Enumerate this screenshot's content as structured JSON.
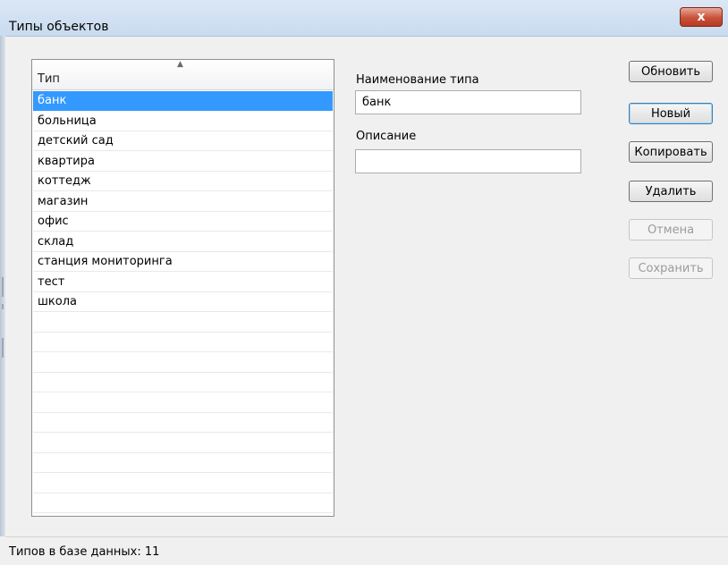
{
  "window": {
    "title": "Типы объектов",
    "close_glyph": "x"
  },
  "list": {
    "column_header": "Тип",
    "sort_glyph": "▲",
    "items": [
      "банк",
      "больница",
      "детский сад",
      "квартира",
      "коттедж",
      "магазин",
      "офис",
      "склад",
      "станция мониторинга",
      "тест",
      "школа"
    ],
    "selected_index": 0
  },
  "form": {
    "name_label": "Наименование типа",
    "name_value": "банк",
    "description_label": "Описание",
    "description_value": ""
  },
  "buttons": {
    "refresh": "Обновить",
    "new": "Новый",
    "copy": "Копировать",
    "delete": "Удалить",
    "cancel": "Отмена",
    "save": "Сохранить"
  },
  "status": {
    "text": "Типов в базе данных: 11"
  },
  "colors": {
    "selection": "#3399ff",
    "close_button": "#c8513a"
  }
}
